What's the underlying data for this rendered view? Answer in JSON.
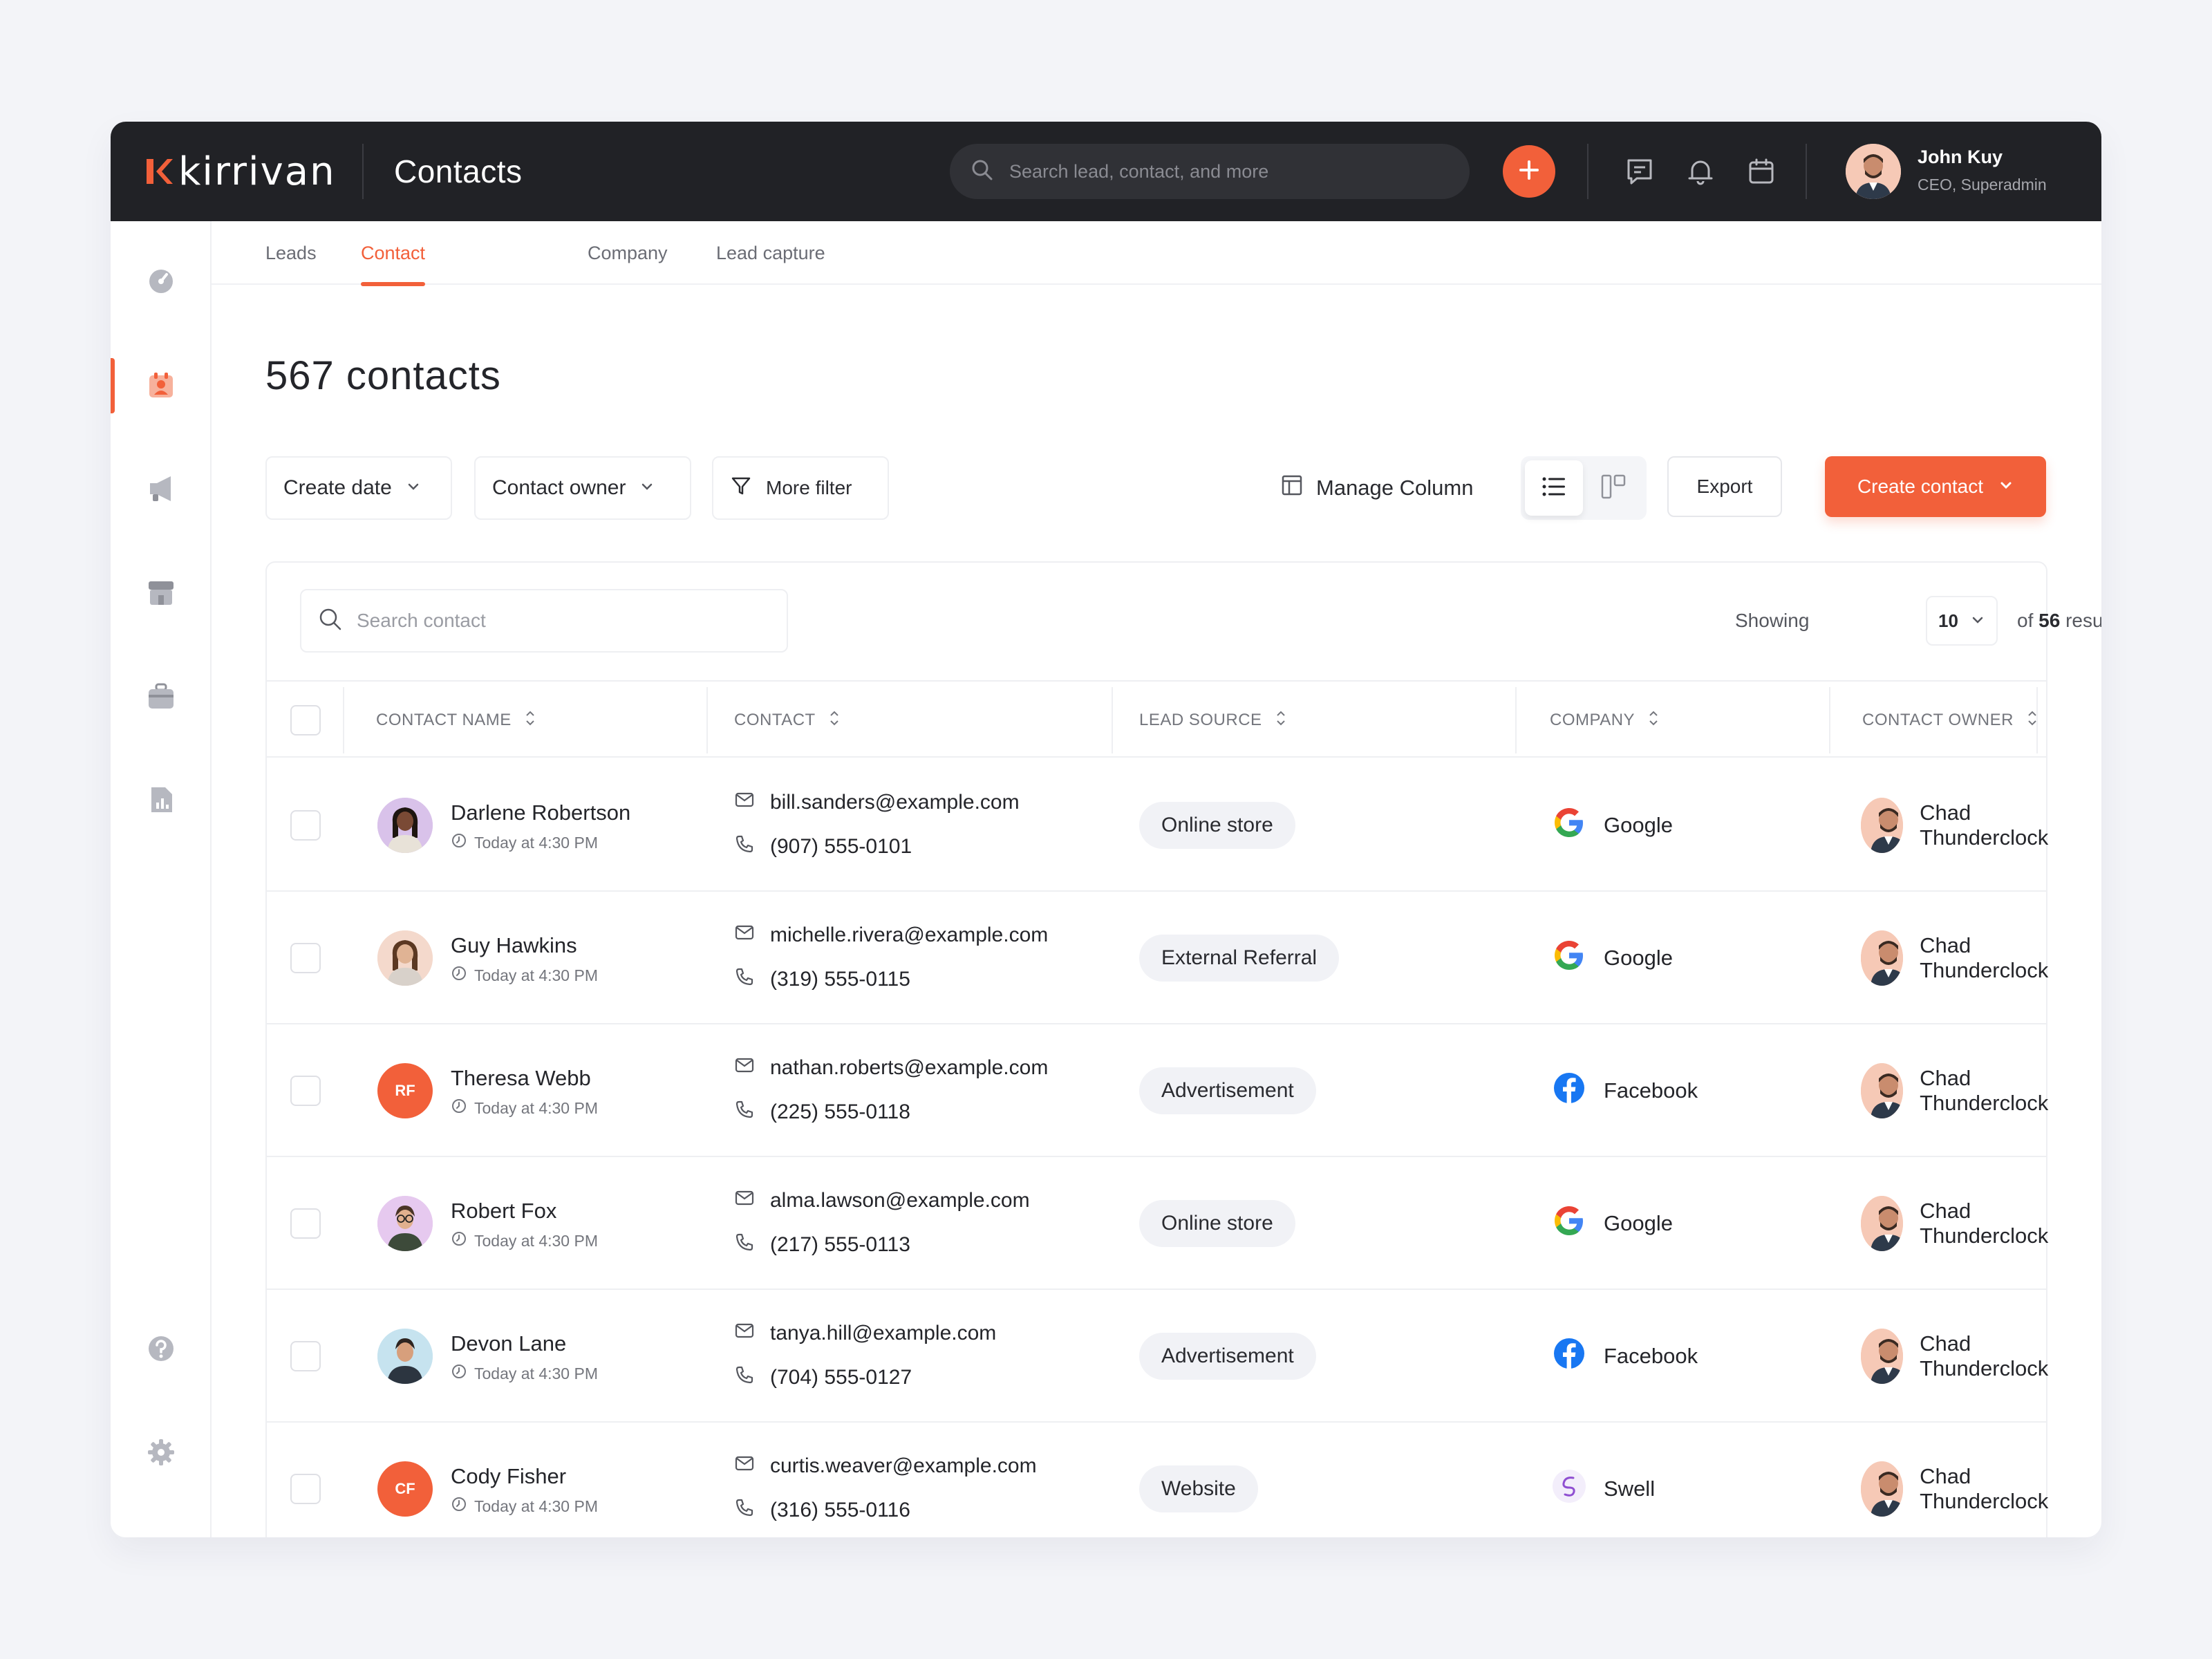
{
  "header": {
    "logo_text": "kirrivan",
    "title": "Contacts",
    "search_placeholder": "Search lead, contact, and more",
    "user": {
      "name": "John Kuy",
      "role": "CEO, Superadmin"
    }
  },
  "tabs": [
    {
      "label": "Leads",
      "active": false
    },
    {
      "label": "Contact",
      "active": true
    },
    {
      "label": "Company",
      "active": false
    },
    {
      "label": "Lead capture",
      "active": false
    }
  ],
  "page": {
    "title": "567 contacts"
  },
  "filters": {
    "create_date": "Create date",
    "contact_owner": "Contact owner",
    "more_filter": "More filter",
    "manage_column": "Manage Column",
    "export": "Export",
    "create_contact": "Create contact"
  },
  "table_controls": {
    "search_placeholder": "Search contact",
    "showing_label": "Showing",
    "page_size": "10",
    "results_prefix": "of",
    "results_count": "56",
    "results_suffix": "results"
  },
  "columns": [
    "CONTACT NAME",
    "CONTACT",
    "LEAD SOURCE",
    "COMPANY",
    "CONTACT OWNER"
  ],
  "rows": [
    {
      "name": "Darlene Robertson",
      "time": "Today at 4:30 PM",
      "email": "bill.sanders@example.com",
      "phone": "(907) 555-0101",
      "source": "Online store",
      "company": "Google",
      "owner": "Chad Thunderclock",
      "avatar": "photo-woman-dark",
      "avatar_color": "#d9c2ea"
    },
    {
      "name": "Guy Hawkins",
      "time": "Today at 4:30 PM",
      "email": "michelle.rivera@example.com",
      "phone": "(319) 555-0115",
      "source": "External Referral",
      "company": "Google",
      "owner": "Chad Thunderclock",
      "avatar": "photo-woman-curly",
      "avatar_color": "#f4d9cc"
    },
    {
      "name": "Theresa Webb",
      "time": "Today at 4:30 PM",
      "email": "nathan.roberts@example.com",
      "phone": "(225) 555-0118",
      "source": "Advertisement",
      "company": "Facebook",
      "owner": "Chad Thunderclock",
      "initials": "RF",
      "avatar_color": "#f2603a"
    },
    {
      "name": "Robert Fox",
      "time": "Today at 4:30 PM",
      "email": "alma.lawson@example.com",
      "phone": "(217) 555-0113",
      "source": "Online store",
      "company": "Google",
      "owner": "Chad Thunderclock",
      "avatar": "photo-man-glasses",
      "avatar_color": "#e6c9ef"
    },
    {
      "name": "Devon Lane",
      "time": "Today at 4:30 PM",
      "email": "tanya.hill@example.com",
      "phone": "(704) 555-0127",
      "source": "Advertisement",
      "company": "Facebook",
      "owner": "Chad Thunderclock",
      "avatar": "photo-man",
      "avatar_color": "#c6e3ef"
    },
    {
      "name": "Cody Fisher",
      "time": "Today at 4:30 PM",
      "email": "curtis.weaver@example.com",
      "phone": "(316) 555-0116",
      "source": "Website",
      "company": "Swell",
      "owner": "Chad Thunderclock",
      "initials": "CF",
      "avatar_color": "#f2603a"
    }
  ],
  "colors": {
    "accent": "#f2603a",
    "topbar": "#212226",
    "google_blue": "#4285f4",
    "facebook_blue": "#1877f2",
    "swell_purple": "#8f4fd1"
  }
}
